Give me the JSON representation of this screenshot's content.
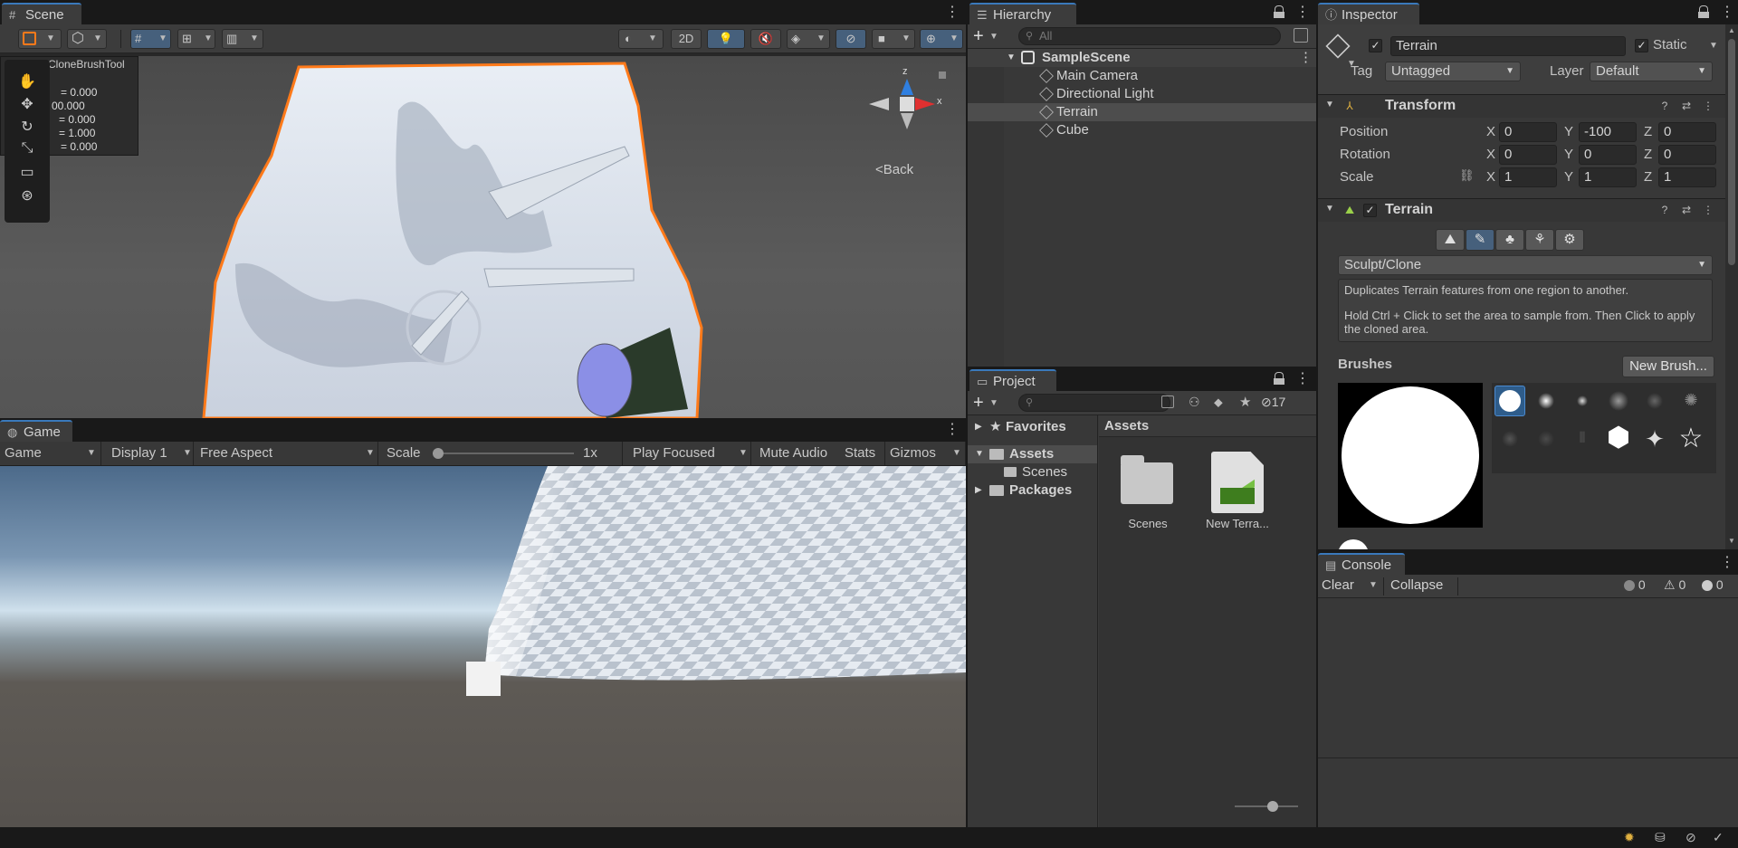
{
  "scene": {
    "tab_label": "Scene",
    "toolbar": {
      "btn_2d": "2D"
    },
    "overlay_title": "CloneBrushTool",
    "overlay_values": [
      "= 0.000",
      "00.000",
      "= 0.000",
      "= 1.000",
      "= 0.000"
    ],
    "back_label": "Back",
    "gizmo_axes": {
      "x": "x",
      "z": "z"
    }
  },
  "game": {
    "tab_label": "Game",
    "toolbar": {
      "mode": "Game",
      "display": "Display 1",
      "aspect": "Free Aspect",
      "scale_label": "Scale",
      "scale_value": "1x",
      "play_mode": "Play Focused",
      "mute": "Mute Audio",
      "stats": "Stats",
      "gizmos": "Gizmos"
    },
    "scale_slider_fraction": 0.0
  },
  "hierarchy": {
    "tab_label": "Hierarchy",
    "search_placeholder": "All",
    "scene_name": "SampleScene",
    "items": [
      {
        "label": "Main Camera"
      },
      {
        "label": "Directional Light"
      },
      {
        "label": "Terrain",
        "selected": true
      },
      {
        "label": "Cube"
      }
    ]
  },
  "project": {
    "tab_label": "Project",
    "hidden_count": "17",
    "tree": {
      "favorites": "Favorites",
      "assets": "Assets",
      "scenes": "Scenes",
      "packages": "Packages"
    },
    "breadcrumb": "Assets",
    "files": [
      {
        "label": "Scenes",
        "icon": "folder-icon"
      },
      {
        "label": "New Terra...",
        "icon": "terrain-data-icon"
      }
    ]
  },
  "inspector": {
    "tab_label": "Inspector",
    "object_name": "Terrain",
    "active": true,
    "static_label": "Static",
    "static_checked": true,
    "tag_label": "Tag",
    "tag_value": "Untagged",
    "layer_label": "Layer",
    "layer_value": "Default",
    "transform": {
      "title": "Transform",
      "position_label": "Position",
      "rotation_label": "Rotation",
      "scale_label": "Scale",
      "axis_x": "X",
      "axis_y": "Y",
      "axis_z": "Z",
      "position": {
        "x": "0",
        "y": "-100",
        "z": "0"
      },
      "rotation": {
        "x": "0",
        "y": "0",
        "z": "0"
      },
      "scale": {
        "x": "1",
        "y": "1",
        "z": "1"
      }
    },
    "terrain": {
      "title": "Terrain",
      "enabled": true,
      "tool_dropdown": "Sculpt/Clone",
      "help_line1": "Duplicates Terrain features from one region to another.",
      "help_line2": "Hold Ctrl + Click to set the area to sample from. Then Click to apply the cloned area.",
      "brushes_label": "Brushes",
      "new_brush": "New Brush..."
    }
  },
  "console": {
    "tab_label": "Console",
    "clear": "Clear",
    "collapse": "Collapse",
    "errors": "0",
    "warnings": "0",
    "logs": "0"
  },
  "colors": {
    "accent": "#3a79bb",
    "selection": "#2c5d87",
    "terrain_outline": "#ff7a1a",
    "panel_bg": "#282828",
    "toolbar_bg": "#3c3c3c"
  }
}
